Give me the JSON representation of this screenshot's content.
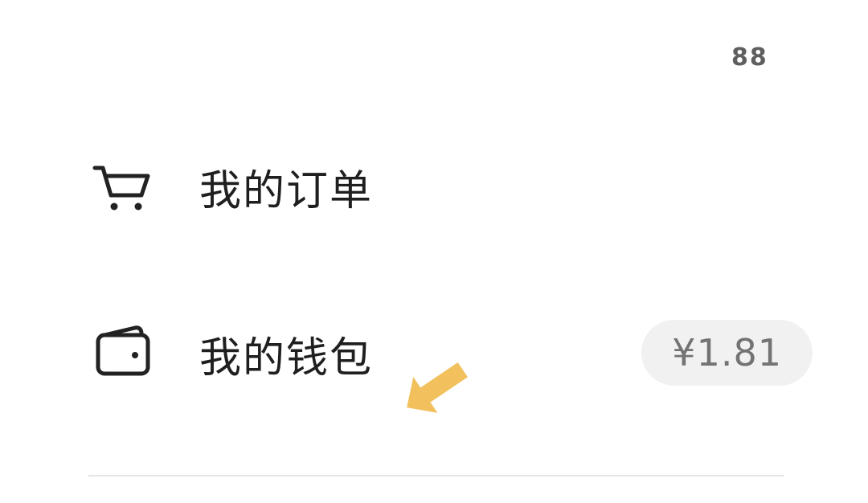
{
  "header": {
    "count_text": "88"
  },
  "menu": {
    "orders": {
      "label": "我的订单",
      "icon": "shopping-cart-icon"
    },
    "wallet": {
      "label": "我的钱包",
      "icon": "wallet-icon",
      "balance": "¥1.81"
    }
  },
  "annotation": {
    "icon": "pointer-arrow-icon",
    "color": "#f2c15e"
  },
  "colors": {
    "text_primary": "#1f1f1f",
    "text_secondary": "#737373",
    "pill_bg": "#f1f1f1",
    "divider": "#e5e5e5"
  }
}
